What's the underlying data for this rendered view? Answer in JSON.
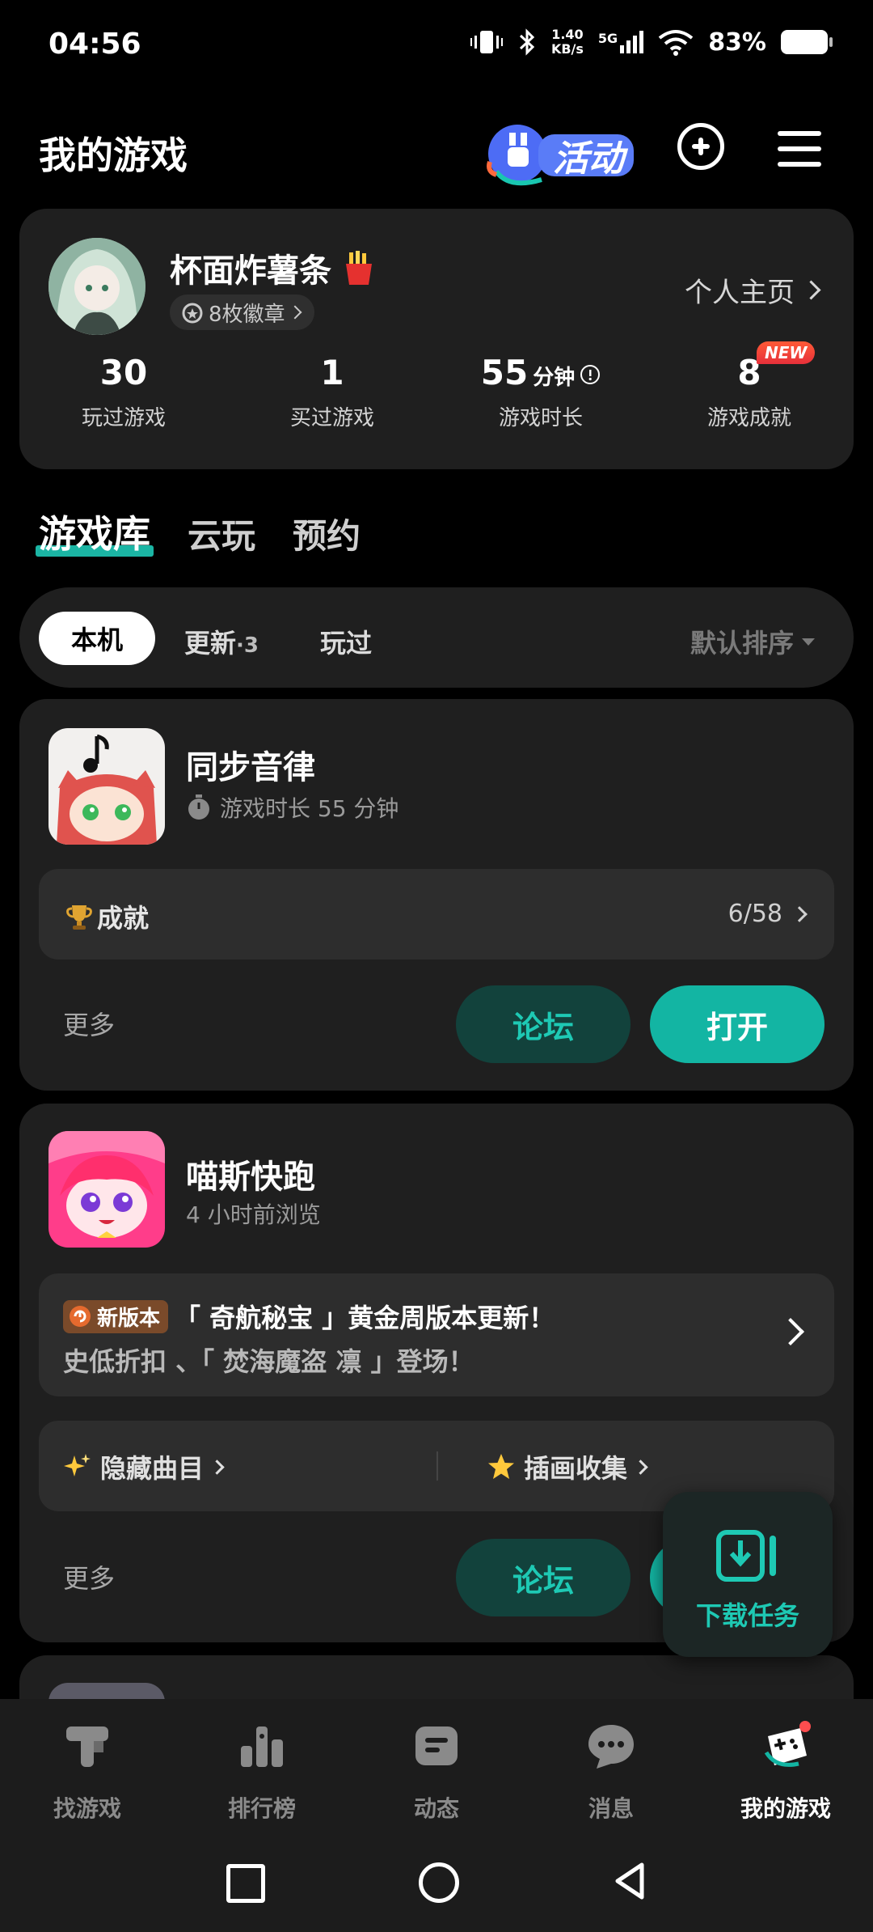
{
  "status_bar": {
    "time": "04:56",
    "net_speed_value": "1.40",
    "net_speed_unit": "KB/s",
    "network": "5G",
    "battery": "83%"
  },
  "header": {
    "title": "我的游戏",
    "event_label": "活动"
  },
  "profile": {
    "username": "杯面炸薯条",
    "badges": "8枚徽章",
    "homepage_link": "个人主页",
    "stats": [
      {
        "value": "30",
        "unit": "",
        "label": "玩过游戏"
      },
      {
        "value": "1",
        "unit": "",
        "label": "买过游戏"
      },
      {
        "value": "55",
        "unit": "分钟",
        "label": "游戏时长"
      },
      {
        "value": "8",
        "unit": "",
        "label": "游戏成就",
        "tag": "NEW"
      }
    ]
  },
  "tabs": [
    "游戏库",
    "云玩",
    "预约"
  ],
  "filters": {
    "active": "本机",
    "update": "更新",
    "update_count": "·3",
    "played": "玩过",
    "sort": "默认排序"
  },
  "games": [
    {
      "name": "同步音律",
      "sub": "游戏时长 55 分钟",
      "achievement_label": "成就",
      "achievement_progress": "6/58",
      "more": "更多",
      "forum": "论坛",
      "open": "打开"
    },
    {
      "name": "喵斯快跑",
      "sub": "4 小时前浏览",
      "new_version_tag": "新版本",
      "update_title": "「 奇航秘宝 」黄金周版本更新！",
      "update_desc": "史低折扣 、「 焚海魔盗 凛 」登场！",
      "links": [
        "隐藏曲目",
        "插画收集"
      ],
      "more": "更多",
      "forum": "论坛"
    }
  ],
  "download_task": "下载任务",
  "bottom_nav": [
    {
      "label": "找游戏",
      "icon": "find-game-icon"
    },
    {
      "label": "排行榜",
      "icon": "ranking-icon"
    },
    {
      "label": "动态",
      "icon": "feed-icon"
    },
    {
      "label": "消息",
      "icon": "message-icon"
    },
    {
      "label": "我的游戏",
      "icon": "my-games-icon"
    }
  ],
  "colors": {
    "accent": "#13b5a3",
    "card_bg": "#1f1f1f",
    "page_bg": "#000000",
    "new_tag": "#e6303a"
  }
}
